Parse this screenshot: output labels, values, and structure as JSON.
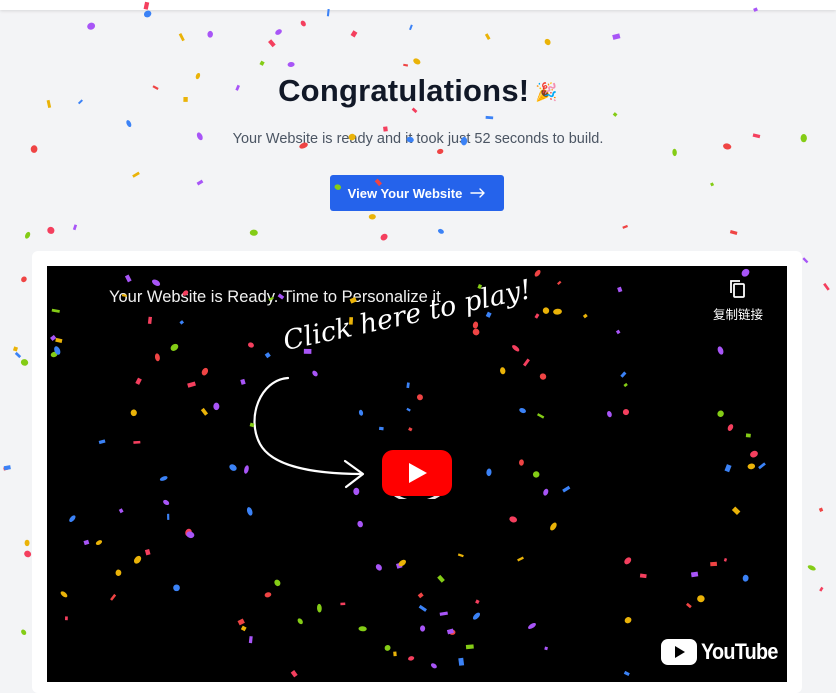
{
  "hero": {
    "title": "Congratulations!",
    "party_emoji": "🎉",
    "subtitle": "Your Website is ready and it took just 52 seconds to build.",
    "cta_label": "View Your Website",
    "cta_icon": "arrow-right-icon"
  },
  "video": {
    "title": "Your Website is Ready. Time to Personalize it",
    "copy_link_label": "复制链接",
    "copy_icon": "copy-icon",
    "overlay_text": "Click here to play!",
    "play_icon": "youtube-play-icon",
    "logo_text": "YouTube"
  },
  "colors": {
    "accent": "#2563eb",
    "youtube_red": "#ff0000",
    "confetti": [
      "#3b82f6",
      "#a855f7",
      "#ef4444",
      "#84cc16",
      "#eab308",
      "#f43f5e"
    ]
  }
}
